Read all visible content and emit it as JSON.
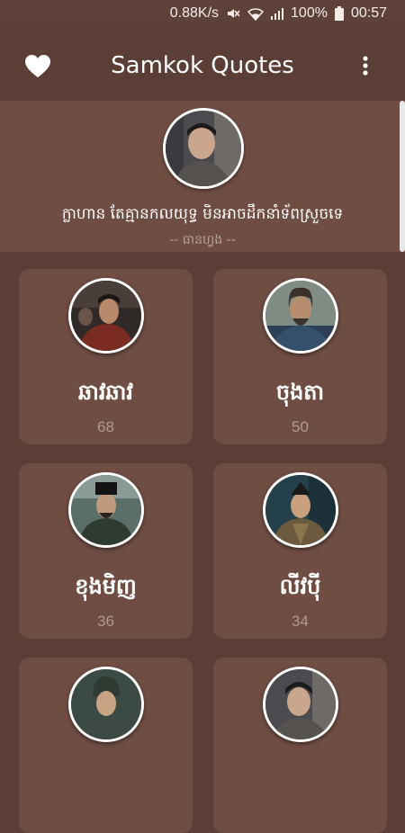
{
  "status_bar": {
    "speed": "0.88K/s",
    "battery": "100%",
    "time": "00:57",
    "icons": [
      "mute-icon",
      "wifi-icon",
      "signal-icon",
      "battery-icon"
    ]
  },
  "app_bar": {
    "title": "Samkok Quotes",
    "left_icon": "heart-icon",
    "right_icon": "more-vert-icon"
  },
  "featured": {
    "quote": "ក្លាហាន តែគ្មានកលយុទ្ធ មិនអាចដឹកនាំទ័ពស្រួចទេ",
    "author": "-- ធានហ្វង --"
  },
  "characters": [
    {
      "name": "ឆាវឆាវ",
      "count": "68"
    },
    {
      "name": "ចុងតា",
      "count": "50"
    },
    {
      "name": "ខុងមិញ",
      "count": "36"
    },
    {
      "name": "លីវប៉ី",
      "count": "34"
    },
    {
      "name": "",
      "count": ""
    },
    {
      "name": "",
      "count": ""
    }
  ],
  "colors": {
    "background": "#5b3f37",
    "card": "#6f4d43",
    "count_text": "#b39a90"
  }
}
